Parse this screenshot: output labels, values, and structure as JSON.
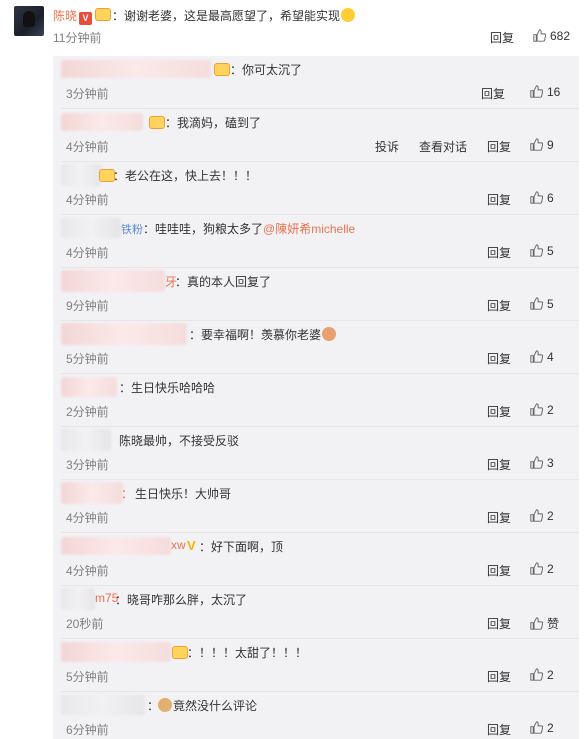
{
  "main_comment": {
    "username": "陈晓",
    "badge": "V",
    "text": "：谢谢老婆，这是最高愿望了，希望能实现",
    "time": "11分钟前",
    "reply_label": "回复",
    "likes": "682"
  },
  "replies": [
    {
      "text": "：你可太沉了",
      "time": "3分钟前",
      "reply": "回复",
      "likes": "16"
    },
    {
      "text": "：我滴妈，磕到了",
      "time": "4分钟前",
      "report": "投诉",
      "view_dialog": "查看对话",
      "reply": "回复",
      "likes": "9"
    },
    {
      "text": "：老公在这，快上去！！！",
      "time": "4分钟前",
      "reply": "回复",
      "likes": "6"
    },
    {
      "prefix": "铁粉",
      "text": "：哇哇哇，狗粮太多了",
      "mention": "@陳妍希michelle",
      "time": "4分钟前",
      "reply": "回复",
      "likes": "5"
    },
    {
      "prefix": "牙",
      "text": "：真的本人回复了",
      "time": "9分钟前",
      "reply": "回复",
      "likes": "5"
    },
    {
      "text": "：要幸福啊！羡慕你老婆",
      "time": "5分钟前",
      "reply": "回复",
      "likes": "4"
    },
    {
      "text": "：生日快乐哈哈哈",
      "time": "2分钟前",
      "reply": "回复",
      "likes": "2"
    },
    {
      "text": "陈晓最帅，不接受反驳",
      "time": "3分钟前",
      "reply": "回复",
      "likes": "3"
    },
    {
      "prefix": "：",
      "text": "生日快乐！大帅哥",
      "time": "4分钟前",
      "reply": "回复",
      "likes": "2"
    },
    {
      "prefix": "xw",
      "text": "：好下面啊，顶",
      "time": "4分钟前",
      "reply": "回复",
      "likes": "2"
    },
    {
      "prefix": "m75",
      "text": "：晓哥咋那么胖，太沉了",
      "time": "20秒前",
      "reply": "回复",
      "likes": "赞"
    },
    {
      "text": "：！！！太甜了！！！",
      "time": "5分钟前",
      "reply": "回复",
      "likes": "2"
    },
    {
      "text": "竟然没什么评论",
      "time": "6分钟前",
      "reply": "回复",
      "likes": "2"
    }
  ]
}
